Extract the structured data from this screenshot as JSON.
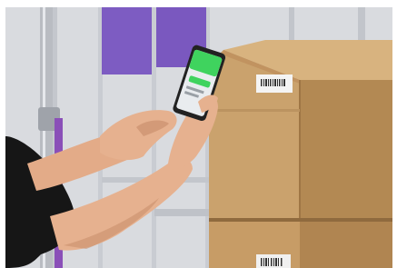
{
  "scene": {
    "subject": "photo",
    "colors": {
      "wall": "#d9dbdf",
      "wall_shadow": "#c4c7cd",
      "purple_panel": "#7d5cc2",
      "box": "#caa26d",
      "box_dark": "#b38953",
      "box_light": "#d8b37f",
      "skin": "#e6b18f",
      "skin_shadow": "#c98f6d",
      "shirt": "#161616",
      "phone_screen": "#3fd35e",
      "phone_body": "#222222",
      "label": "#f4f4f4"
    }
  }
}
